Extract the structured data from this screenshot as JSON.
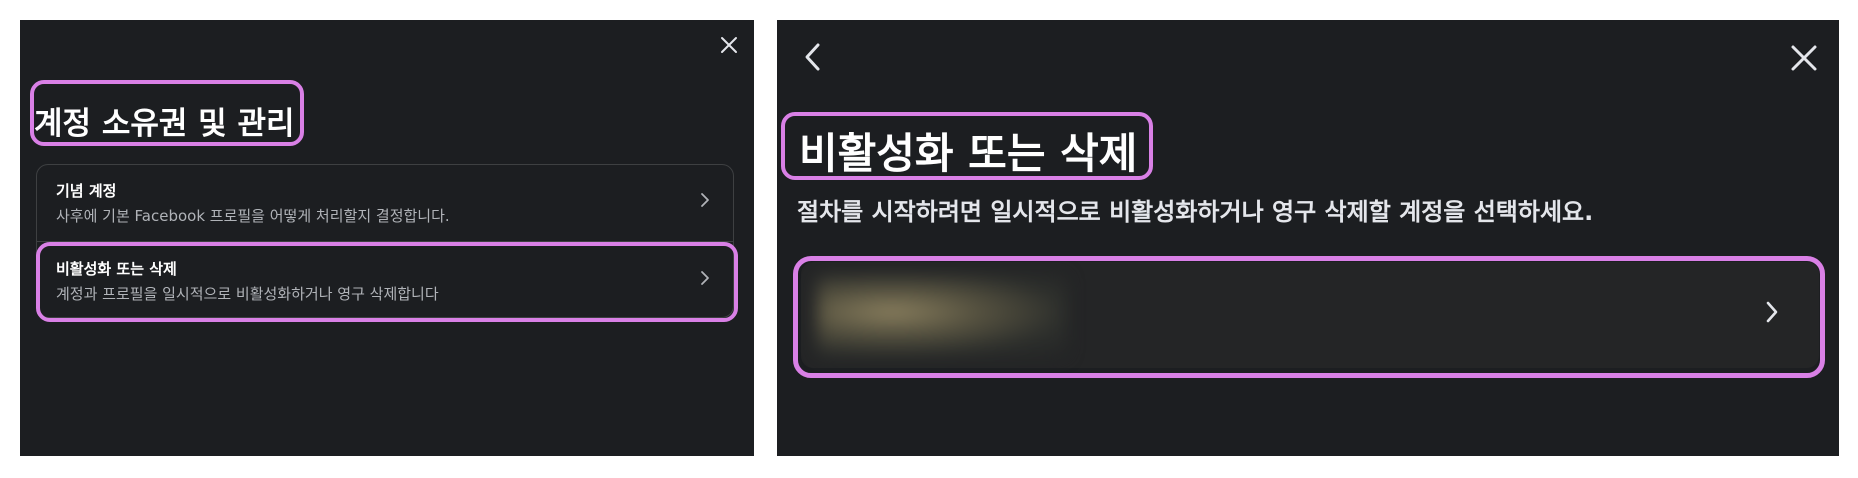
{
  "left_panel": {
    "title": "계정 소유권 및 관리",
    "rows": [
      {
        "title": "기념 계정",
        "subtitle": "사후에 기본 Facebook 프로필을 어떻게 처리할지 결정합니다."
      },
      {
        "title": "비활성화 또는 삭제",
        "subtitle": "계정과 프로필을 일시적으로 비활성화하거나 영구 삭제합니다"
      }
    ]
  },
  "right_panel": {
    "title": "비활성화 또는 삭제",
    "subtitle": "절차를 시작하려면 일시적으로 비활성화하거나 영구 삭제할 계정을 선택하세요."
  },
  "icons": {
    "close": "close-icon",
    "back": "chevron-left-icon",
    "row_chevron": "chevron-right-icon"
  },
  "colors": {
    "panel_background": "#1c1e21",
    "card_background": "#242526",
    "highlight": "#d980e6",
    "text_primary": "#ffffff",
    "text_secondary": "#b0b3b8"
  }
}
